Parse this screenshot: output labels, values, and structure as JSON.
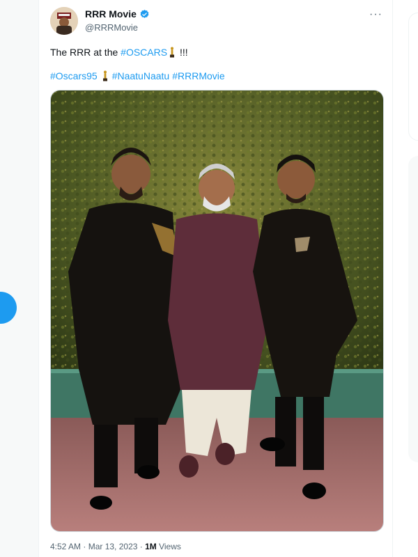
{
  "tweet": {
    "display_name": "RRR Movie",
    "handle": "@RRRMovie",
    "text_prefix": "The RRR at the ",
    "text_hashtag": "#OSCARS",
    "text_suffix": " !!!",
    "hashtags": [
      "#Oscars95",
      "#NaatuNaatu",
      "#RRRMovie"
    ],
    "more_label": "···",
    "time": "4:52 AM",
    "sep1": " · ",
    "date": "Mar 13, 2023",
    "sep2": " · ",
    "views_count": "1M",
    "views_label": " Views"
  },
  "colors": {
    "accent": "#1d9bf0",
    "text": "#0f1419",
    "muted": "#536471"
  },
  "icons": {
    "verified": "verified-badge-icon",
    "oscar": "oscar-statuette-icon",
    "more": "more-horizontal-icon"
  }
}
